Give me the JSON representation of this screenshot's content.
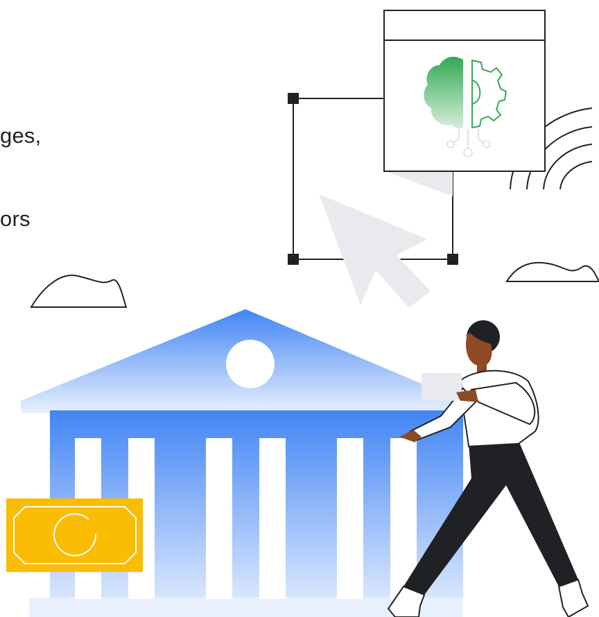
{
  "text_fragment": {
    "line_1": "ges,",
    "line_2": "ors"
  },
  "colors": {
    "text": "#202124",
    "building_top": "#4285f4",
    "building_bottom": "#e8f0fe",
    "banknote": "#fbbc04",
    "brain": "#34a853",
    "cursor": "#e8eaed",
    "line": "#202124",
    "skin": "#8d4a24",
    "trousers": "#202124",
    "shirt": "#ffffff"
  },
  "icons": [
    "window-icon",
    "brain-gear-icon",
    "selection-frame-icon",
    "cursor-arrow-icon",
    "signal-arcs-icon",
    "cloud-icon",
    "bank-building-icon",
    "banknote-icon",
    "walking-person-icon"
  ]
}
